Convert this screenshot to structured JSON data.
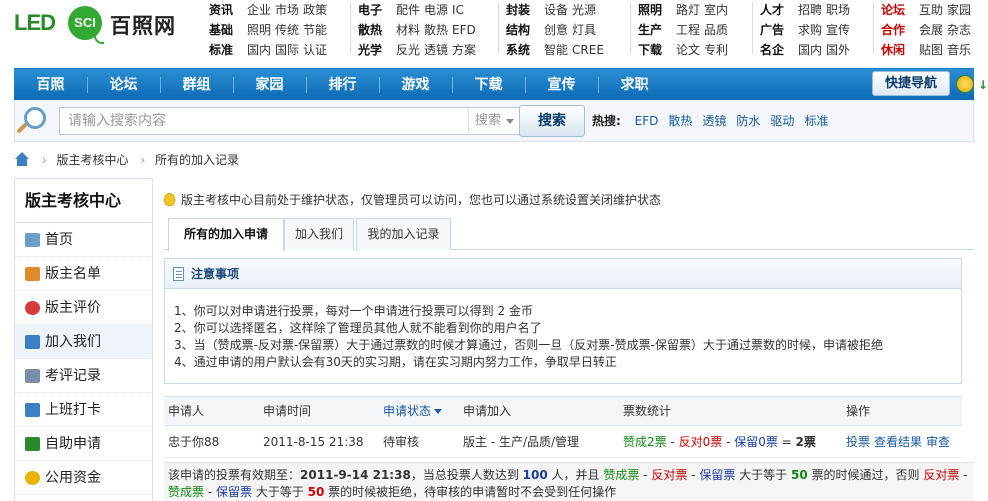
{
  "logo": {
    "led": "LED",
    "sci": "SCI",
    "name": "百照网"
  },
  "header_links": [
    {
      "rows": [
        {
          "cat": "资讯",
          "links": [
            "企业",
            "市场",
            "政策"
          ]
        },
        {
          "cat": "基础",
          "links": [
            "照明",
            "传统",
            "节能"
          ]
        },
        {
          "cat": "标准",
          "links": [
            "国内",
            "国际",
            "认证"
          ]
        }
      ]
    },
    {
      "rows": [
        {
          "cat": "电子",
          "links": [
            "配件",
            "电源",
            "IC"
          ]
        },
        {
          "cat": "散热",
          "links": [
            "材料",
            "散热",
            "EFD"
          ]
        },
        {
          "cat": "光学",
          "links": [
            "反光",
            "透镜",
            "方案"
          ]
        }
      ]
    },
    {
      "rows": [
        {
          "cat": "封装",
          "links": [
            "设备",
            "光源"
          ]
        },
        {
          "cat": "结构",
          "links": [
            "创意",
            "灯具"
          ]
        },
        {
          "cat": "系统",
          "links": [
            "智能",
            "CREE"
          ]
        }
      ]
    },
    {
      "rows": [
        {
          "cat": "照明",
          "links": [
            "路灯",
            "室内"
          ]
        },
        {
          "cat": "生产",
          "links": [
            "工程",
            "品质"
          ]
        },
        {
          "cat": "下载",
          "links": [
            "论文",
            "专利"
          ]
        }
      ]
    },
    {
      "rows": [
        {
          "cat": "人才",
          "links": [
            "招聘",
            "职场"
          ]
        },
        {
          "cat": "广告",
          "links": [
            "求购",
            "宣传"
          ]
        },
        {
          "cat": "名企",
          "links": [
            "国内",
            "国外"
          ]
        }
      ]
    },
    {
      "rows": [
        {
          "cat": "论坛",
          "links": [
            "互助",
            "家园"
          ]
        },
        {
          "cat": "合作",
          "links": [
            "会展",
            "杂志"
          ]
        },
        {
          "cat": "休闲",
          "links": [
            "贴图",
            "音乐"
          ]
        }
      ]
    }
  ],
  "nav": {
    "items": [
      "百照",
      "论坛",
      "群组",
      "家园",
      "排行",
      "游戏",
      "下载",
      "宣传",
      "求职"
    ],
    "quick_nav": "快捷导航"
  },
  "search": {
    "placeholder": "请输入搜索内容",
    "select_value": "搜索",
    "button": "搜索",
    "hot_label": "热搜:",
    "hot_links": [
      "EFD",
      "散热",
      "透镜",
      "防水",
      "驱动",
      "标准"
    ]
  },
  "breadcrumb": [
    "版主考核中心",
    "所有的加入记录"
  ],
  "sidebar": {
    "title": "版主考核中心",
    "items": [
      {
        "label": "首页",
        "icon": "home-page-icon",
        "color": "#6a9fcc"
      },
      {
        "label": "版主名单",
        "icon": "users-icon",
        "color": "#e08a2a"
      },
      {
        "label": "版主评价",
        "icon": "hearts-icon",
        "color": "#d63a3a"
      },
      {
        "label": "加入我们",
        "icon": "add-user-icon",
        "color": "#3b7fc4"
      },
      {
        "label": "考评记录",
        "icon": "records-icon",
        "color": "#7a8ea8"
      },
      {
        "label": "上班打卡",
        "icon": "card-icon",
        "color": "#3b7fc4"
      },
      {
        "label": "自助申请",
        "icon": "apply-icon",
        "color": "#2a8a2a"
      },
      {
        "label": "公用资金",
        "icon": "coins-icon",
        "color": "#e8b400"
      }
    ],
    "active_index": 3
  },
  "notice": "版主考核中心目前处于维护状态，仅管理员可以访问，您也可以通过系统设置关闭维护状态",
  "tabs": [
    "所有的加入申请",
    "加入我们",
    "我的加入记录"
  ],
  "notes": {
    "title": "注意事项",
    "items": [
      "1、你可以对申请进行投票，每对一个申请进行投票可以得到 2 金币",
      "2、你可以选择匿名，这样除了管理员其他人就不能看到你的用户名了",
      "3、当（赞成票-反对票-保留票）大于通过票数的时候才算通过，否则一旦（反对票-赞成票-保留票）大于通过票数的时候，申请被拒绝",
      "4、通过申请的用户默认会有30天的实习期，请在实习期内努力工作，争取早日转正"
    ]
  },
  "table": {
    "headers": {
      "applicant": "申请人",
      "time": "申请时间",
      "status": "申请状态",
      "join": "申请加入",
      "votes": "票数统计",
      "action": "操作"
    },
    "rows": [
      {
        "applicant": "忠于你88",
        "time": "2011-8-15 21:38",
        "status": "待审核",
        "join": "版主 - 生产/品质/管理",
        "v_yes": "赞成2票",
        "v_sep1": " - ",
        "v_no": "反对0票",
        "v_sep2": " - ",
        "v_keep": "保留0票",
        "v_eq": " = ",
        "v_total": "2票",
        "actions": [
          "投票",
          "查看结果",
          "审查"
        ]
      }
    ]
  },
  "footer": {
    "t1": "该申请的投票有效期至：",
    "deadline": "2011-9-14 21:38",
    "t2": "，当总投票人数达到 ",
    "voters": "100",
    "t3": " 人，并且 ",
    "yes": "赞成票",
    "dash1": " - ",
    "no": "反对票",
    "dash2": " - ",
    "keep": "保留票",
    "t4": " 大于等于 ",
    "pass_votes": "50",
    "t5": " 票的时候通过，否则 ",
    "no2": "反对票",
    "dash3": " - ",
    "yes2": "赞成票",
    "dash4": " - ",
    "keep2": "保留票",
    "t6": " 大于等于 ",
    "reject_votes": "50",
    "t7": " 票的时候被拒绝，待审核的申请暂时不会受到任何操作"
  }
}
